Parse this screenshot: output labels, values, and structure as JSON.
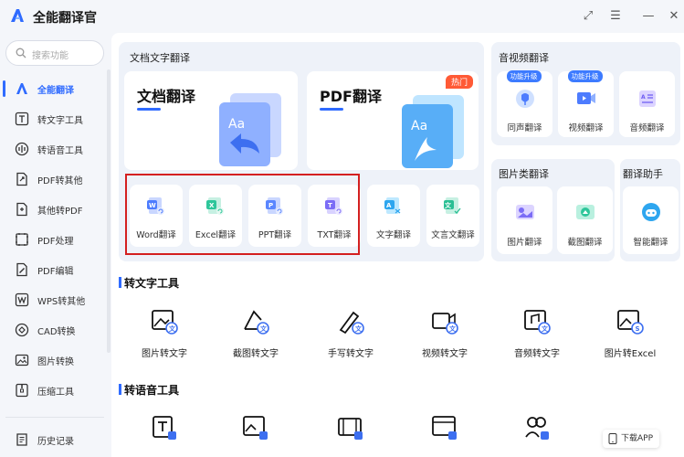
{
  "app": {
    "title": "全能翻译官"
  },
  "window_controls": {
    "pin": "⤢",
    "menu": "☰",
    "minimize": "—"
  },
  "search": {
    "placeholder": "搜索功能"
  },
  "sidebar": {
    "items": [
      {
        "label": "全能翻译",
        "active": true
      },
      {
        "label": "转文字工具"
      },
      {
        "label": "转语音工具"
      },
      {
        "label": "PDF转其他"
      },
      {
        "label": "其他转PDF"
      },
      {
        "label": "PDF处理"
      },
      {
        "label": "PDF编辑"
      },
      {
        "label": "WPS转其他"
      },
      {
        "label": "CAD转换"
      },
      {
        "label": "图片转换"
      },
      {
        "label": "压缩工具"
      }
    ],
    "history": "历史记录"
  },
  "doc_panel": {
    "title": "文档文字翻译",
    "doc_card": "文档翻译",
    "pdf_card": "PDF翻译",
    "hot_badge": "热门",
    "tiles": [
      "Word翻译",
      "Excel翻译",
      "PPT翻译",
      "TXT翻译",
      "文字翻译",
      "文言文翻译"
    ]
  },
  "av_panel": {
    "title": "音视频翻译",
    "tiles": [
      {
        "label": "同声翻译",
        "badge": "功能升级"
      },
      {
        "label": "视频翻译",
        "badge": "功能升级"
      },
      {
        "label": "音频翻译"
      }
    ]
  },
  "img_panel": {
    "title": "图片类翻译",
    "tiles": [
      "图片翻译",
      "截图翻译"
    ]
  },
  "assistant_panel": {
    "title": "翻译助手",
    "tiles": [
      "智能翻译"
    ]
  },
  "text_tools": {
    "title": "转文字工具",
    "items": [
      "图片转文字",
      "截图转文字",
      "手写转文字",
      "视频转文字",
      "音频转文字",
      "图片转Excel"
    ]
  },
  "voice_tools": {
    "title": "转语音工具"
  },
  "download": {
    "label": "下载APP"
  },
  "colors": {
    "accent": "#2f6bff",
    "highlight": "#d42020",
    "hot": "#ff5a36"
  }
}
